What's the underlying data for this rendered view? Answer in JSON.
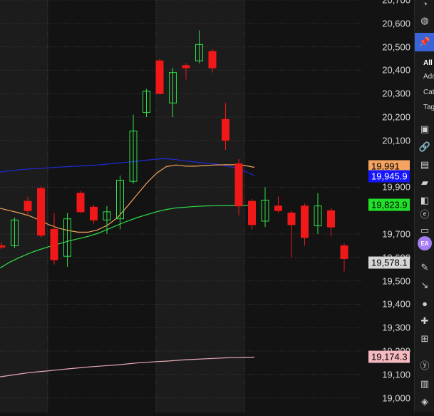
{
  "chart_data": {
    "type": "candlestick",
    "y_ticks": [
      "20,700",
      "20,600",
      "20,500",
      "20,400",
      "20,300",
      "20,200",
      "20,100",
      "19,900",
      "19,700",
      "19,600",
      "19,500",
      "19,400",
      "19,300",
      "19,200",
      "19,100",
      "19,000"
    ],
    "y_tick_values": [
      20700,
      20600,
      20500,
      20400,
      20300,
      20200,
      20100,
      19900,
      19700,
      19600,
      19500,
      19400,
      19300,
      19200,
      19100,
      19000
    ],
    "ylim": [
      18970,
      20720
    ],
    "candles": [
      {
        "o": 19650,
        "h": 19665,
        "l": 19635,
        "c": 19645
      },
      {
        "o": 19650,
        "h": 19770,
        "l": 19640,
        "c": 19760
      },
      {
        "o": 19840,
        "h": 19860,
        "l": 19780,
        "c": 19800
      },
      {
        "o": 19895,
        "h": 19905,
        "l": 19685,
        "c": 19695
      },
      {
        "o": 19720,
        "h": 19790,
        "l": 19570,
        "c": 19590
      },
      {
        "o": 19605,
        "h": 19790,
        "l": 19560,
        "c": 19765
      },
      {
        "o": 19875,
        "h": 19885,
        "l": 19790,
        "c": 19795
      },
      {
        "o": 19815,
        "h": 19825,
        "l": 19745,
        "c": 19760
      },
      {
        "o": 19760,
        "h": 19820,
        "l": 19700,
        "c": 19795
      },
      {
        "o": 19765,
        "h": 19950,
        "l": 19720,
        "c": 19930
      },
      {
        "o": 19925,
        "h": 20210,
        "l": 19915,
        "c": 20140
      },
      {
        "o": 20220,
        "h": 20320,
        "l": 20200,
        "c": 20310
      },
      {
        "o": 20440,
        "h": 20450,
        "l": 20300,
        "c": 20300
      },
      {
        "o": 20260,
        "h": 20410,
        "l": 20200,
        "c": 20390
      },
      {
        "o": 20420,
        "h": 20430,
        "l": 20360,
        "c": 20410
      },
      {
        "o": 20440,
        "h": 20570,
        "l": 20430,
        "c": 20510
      },
      {
        "o": 20480,
        "h": 20490,
        "l": 20390,
        "c": 20410
      },
      {
        "o": 20190,
        "h": 20260,
        "l": 20060,
        "c": 20100
      },
      {
        "o": 20000,
        "h": 20020,
        "l": 19780,
        "c": 19820
      },
      {
        "o": 19840,
        "h": 19850,
        "l": 19720,
        "c": 19740
      },
      {
        "o": 19755,
        "h": 19900,
        "l": 19730,
        "c": 19845
      },
      {
        "o": 19820,
        "h": 19860,
        "l": 19790,
        "c": 19800
      },
      {
        "o": 19790,
        "h": 19800,
        "l": 19600,
        "c": 19740
      },
      {
        "o": 19820,
        "h": 19830,
        "l": 19650,
        "c": 19685
      },
      {
        "o": 19735,
        "h": 19875,
        "l": 19700,
        "c": 19820
      },
      {
        "o": 19800,
        "h": 19810,
        "l": 19690,
        "c": 19730
      },
      {
        "o": 19650,
        "h": 19660,
        "l": 19540,
        "c": 19595
      }
    ],
    "series": [
      {
        "color": "#1f2ad8",
        "values": [
          19965,
          19970,
          19975,
          19978,
          19980,
          19983,
          19986,
          19988,
          19990,
          19993,
          19995,
          19999,
          20003,
          20007,
          20011,
          20016,
          20020,
          20022,
          20018,
          20012,
          20008,
          20003,
          19999,
          19993,
          19983,
          19968,
          19950
        ]
      },
      {
        "color": "#f1a45a",
        "values": [
          19810,
          19800,
          19790,
          19778,
          19760,
          19740,
          19725,
          19715,
          19708,
          19708,
          19718,
          19738,
          19770,
          19818,
          19868,
          19918,
          19960,
          19988,
          19995,
          19990,
          19990,
          19993,
          19995,
          19996,
          19996,
          19993,
          19985
        ]
      },
      {
        "color": "#2fe04a",
        "values": [
          19555,
          19580,
          19600,
          19618,
          19633,
          19646,
          19658,
          19670,
          19680,
          19690,
          19703,
          19720,
          19738,
          19755,
          19770,
          19783,
          19795,
          19805,
          19812,
          19815,
          19818,
          19820,
          19821,
          19822,
          19823,
          19823,
          19823
        ]
      },
      {
        "color": "#e8aab6",
        "values": [
          19090,
          19096,
          19102,
          19108,
          19112,
          19116,
          19120,
          19124,
          19128,
          19132,
          19135,
          19138,
          19141,
          19145,
          19149,
          19152,
          19155,
          19157,
          19160,
          19163,
          19165,
          19167,
          19169,
          19171,
          19172,
          19173,
          19174
        ]
      }
    ],
    "price_tags": [
      {
        "label": "19,991",
        "value": 19991,
        "bg": "#f4a460",
        "fg": "#000000"
      },
      {
        "label": "19,945.9",
        "value": 19945.9,
        "bg": "#1515ff",
        "fg": "#ffffff"
      },
      {
        "label": "19,823.9",
        "value": 19823.9,
        "bg": "#22e02a",
        "fg": "#000000"
      },
      {
        "label": "19,578.1",
        "value": 19578.1,
        "bg": "#d6d6d6",
        "fg": "#000000"
      },
      {
        "label": "19,174.3",
        "value": 19174.3,
        "bg": "#f5b9c2",
        "fg": "#000000"
      }
    ],
    "colors": {
      "up": "#2fe04a",
      "down": "#f01818",
      "wick": "#c8c8c8",
      "grid": "#3a3a3a",
      "bg": "#131313",
      "band": "#1c1c1c"
    }
  },
  "sidebar": {
    "all_label": "All",
    "items": [
      "Ado",
      "Cat",
      "Tag"
    ]
  }
}
